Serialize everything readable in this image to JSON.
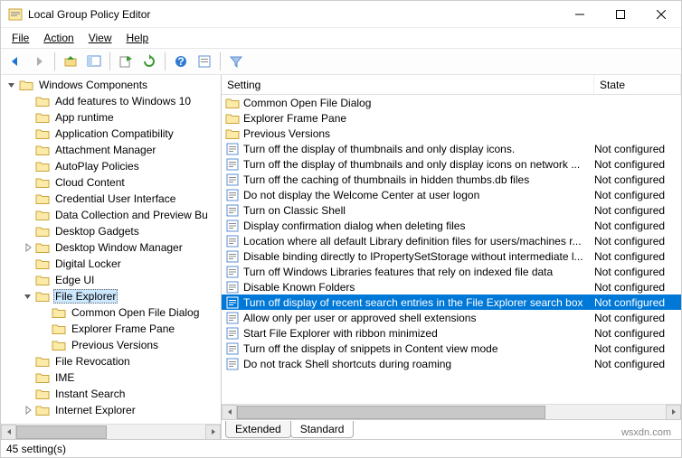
{
  "window": {
    "title": "Local Group Policy Editor",
    "status": "45 setting(s)",
    "brand": "wsxdn.com"
  },
  "menus": [
    "File",
    "Action",
    "View",
    "Help"
  ],
  "toolbar_icons": [
    "back",
    "forward",
    "sep",
    "up",
    "properties",
    "sep",
    "export",
    "refresh",
    "sep",
    "help",
    "props2",
    "sep",
    "filter"
  ],
  "tree": [
    {
      "depth": 0,
      "exp": "open",
      "label": "Windows Components"
    },
    {
      "depth": 1,
      "exp": "none",
      "label": "Add features to Windows 10"
    },
    {
      "depth": 1,
      "exp": "none",
      "label": "App runtime"
    },
    {
      "depth": 1,
      "exp": "none",
      "label": "Application Compatibility"
    },
    {
      "depth": 1,
      "exp": "none",
      "label": "Attachment Manager"
    },
    {
      "depth": 1,
      "exp": "none",
      "label": "AutoPlay Policies"
    },
    {
      "depth": 1,
      "exp": "none",
      "label": "Cloud Content"
    },
    {
      "depth": 1,
      "exp": "none",
      "label": "Credential User Interface"
    },
    {
      "depth": 1,
      "exp": "none",
      "label": "Data Collection and Preview Bu"
    },
    {
      "depth": 1,
      "exp": "none",
      "label": "Desktop Gadgets"
    },
    {
      "depth": 1,
      "exp": "closed",
      "label": "Desktop Window Manager"
    },
    {
      "depth": 1,
      "exp": "none",
      "label": "Digital Locker"
    },
    {
      "depth": 1,
      "exp": "none",
      "label": "Edge UI"
    },
    {
      "depth": 1,
      "exp": "open",
      "label": "File Explorer",
      "selected": true
    },
    {
      "depth": 2,
      "exp": "none",
      "label": "Common Open File Dialog"
    },
    {
      "depth": 2,
      "exp": "none",
      "label": "Explorer Frame Pane"
    },
    {
      "depth": 2,
      "exp": "none",
      "label": "Previous Versions"
    },
    {
      "depth": 1,
      "exp": "none",
      "label": "File Revocation"
    },
    {
      "depth": 1,
      "exp": "none",
      "label": "IME"
    },
    {
      "depth": 1,
      "exp": "none",
      "label": "Instant Search"
    },
    {
      "depth": 1,
      "exp": "closed",
      "label": "Internet Explorer"
    }
  ],
  "columns": {
    "setting": "Setting",
    "state": "State"
  },
  "rows": [
    {
      "icon": "folder",
      "text": "Common Open File Dialog",
      "state": ""
    },
    {
      "icon": "folder",
      "text": "Explorer Frame Pane",
      "state": ""
    },
    {
      "icon": "folder",
      "text": "Previous Versions",
      "state": ""
    },
    {
      "icon": "setting",
      "text": "Turn off the display of thumbnails and only display icons.",
      "state": "Not configured"
    },
    {
      "icon": "setting",
      "text": "Turn off the display of thumbnails and only display icons on network ...",
      "state": "Not configured"
    },
    {
      "icon": "setting",
      "text": "Turn off the caching of thumbnails in hidden thumbs.db files",
      "state": "Not configured"
    },
    {
      "icon": "setting",
      "text": "Do not display the Welcome Center at user logon",
      "state": "Not configured"
    },
    {
      "icon": "setting",
      "text": "Turn on Classic Shell",
      "state": "Not configured"
    },
    {
      "icon": "setting",
      "text": "Display confirmation dialog when deleting files",
      "state": "Not configured"
    },
    {
      "icon": "setting",
      "text": "Location where all default Library definition files for users/machines r...",
      "state": "Not configured"
    },
    {
      "icon": "setting",
      "text": "Disable binding directly to IPropertySetStorage without intermediate l...",
      "state": "Not configured"
    },
    {
      "icon": "setting",
      "text": "Turn off Windows Libraries features that rely on indexed file data",
      "state": "Not configured"
    },
    {
      "icon": "setting",
      "text": "Disable Known Folders",
      "state": "Not configured"
    },
    {
      "icon": "setting",
      "text": "Turn off display of recent search entries in the File Explorer search box",
      "state": "Not configured",
      "selected": true
    },
    {
      "icon": "setting",
      "text": "Allow only per user or approved shell extensions",
      "state": "Not configured"
    },
    {
      "icon": "setting",
      "text": "Start File Explorer with ribbon minimized",
      "state": "Not configured"
    },
    {
      "icon": "setting",
      "text": "Turn off the display of snippets in Content view mode",
      "state": "Not configured"
    },
    {
      "icon": "setting",
      "text": "Do not track Shell shortcuts during roaming",
      "state": "Not configured"
    }
  ],
  "tabs": {
    "extended": "Extended",
    "standard": "Standard"
  }
}
